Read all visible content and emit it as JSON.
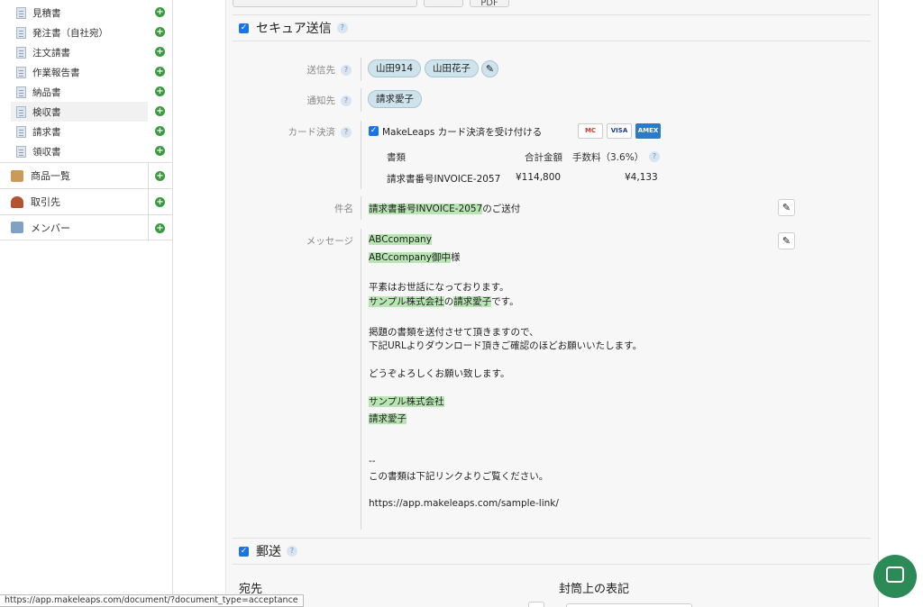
{
  "sidebar": {
    "sub_items": [
      {
        "label": "見積書"
      },
      {
        "label": "発注書（自社宛）"
      },
      {
        "label": "注文請書"
      },
      {
        "label": "作業報告書"
      },
      {
        "label": "納品書"
      },
      {
        "label": "検収書"
      },
      {
        "label": "請求書"
      },
      {
        "label": "領収書"
      }
    ],
    "main_items": [
      {
        "label": "商品一覧"
      },
      {
        "label": "取引先"
      },
      {
        "label": "メンバー"
      }
    ],
    "plus_symbol": "+"
  },
  "toolbar": {
    "pdf_label": "PDF"
  },
  "secure": {
    "title": "セキュア送信",
    "help": "?",
    "to_label": "送信先",
    "recipients": [
      "山田914",
      "山田花子"
    ],
    "cc_label": "通知先",
    "cc": [
      "請求愛子"
    ],
    "card_label": "カード決済",
    "card_checkbox_label": "MakeLeaps カード決済を受け付ける",
    "card_brands": [
      "MC",
      "VISA",
      "AMEX"
    ],
    "card_table": {
      "headers": [
        "書類",
        "合計金額",
        "手数料（3.6%）"
      ],
      "row": [
        "請求書番号INVOICE-2057",
        "¥114,800",
        "¥4,133"
      ]
    },
    "subject_label": "件名",
    "subject_highlight": "請求書番号INVOICE-2057",
    "subject_rest": "のご送付",
    "message_label": "メッセージ",
    "message": {
      "line1": "ABCcompany",
      "line2_hl": "ABCcompany御中",
      "line2_rest": "様",
      "greeting": "平素はお世話になっております。",
      "company_hl": "サンプル株式会社",
      "no": "の",
      "person_hl": "請求愛子",
      "desu": "です。",
      "body1": "掲題の書類を送付させて頂きますので、",
      "body2": "下記URLよりダウンロード頂きご確認のほどお願いいたします。",
      "closing": "どうぞよろしくお願い致します。",
      "sig_company": "サンプル株式会社",
      "sig_person": "請求愛子",
      "dashes": "--",
      "link_note": "この書類は下記リンクよりご覧ください。",
      "url": "https://app.makeleaps.com/sample-link/"
    }
  },
  "mail": {
    "title": "郵送",
    "help": "?",
    "address_label": "宛先",
    "envelope_label": "封筒上の表記"
  },
  "status_url": "https://app.makeleaps.com/document/?document_type=acceptance"
}
